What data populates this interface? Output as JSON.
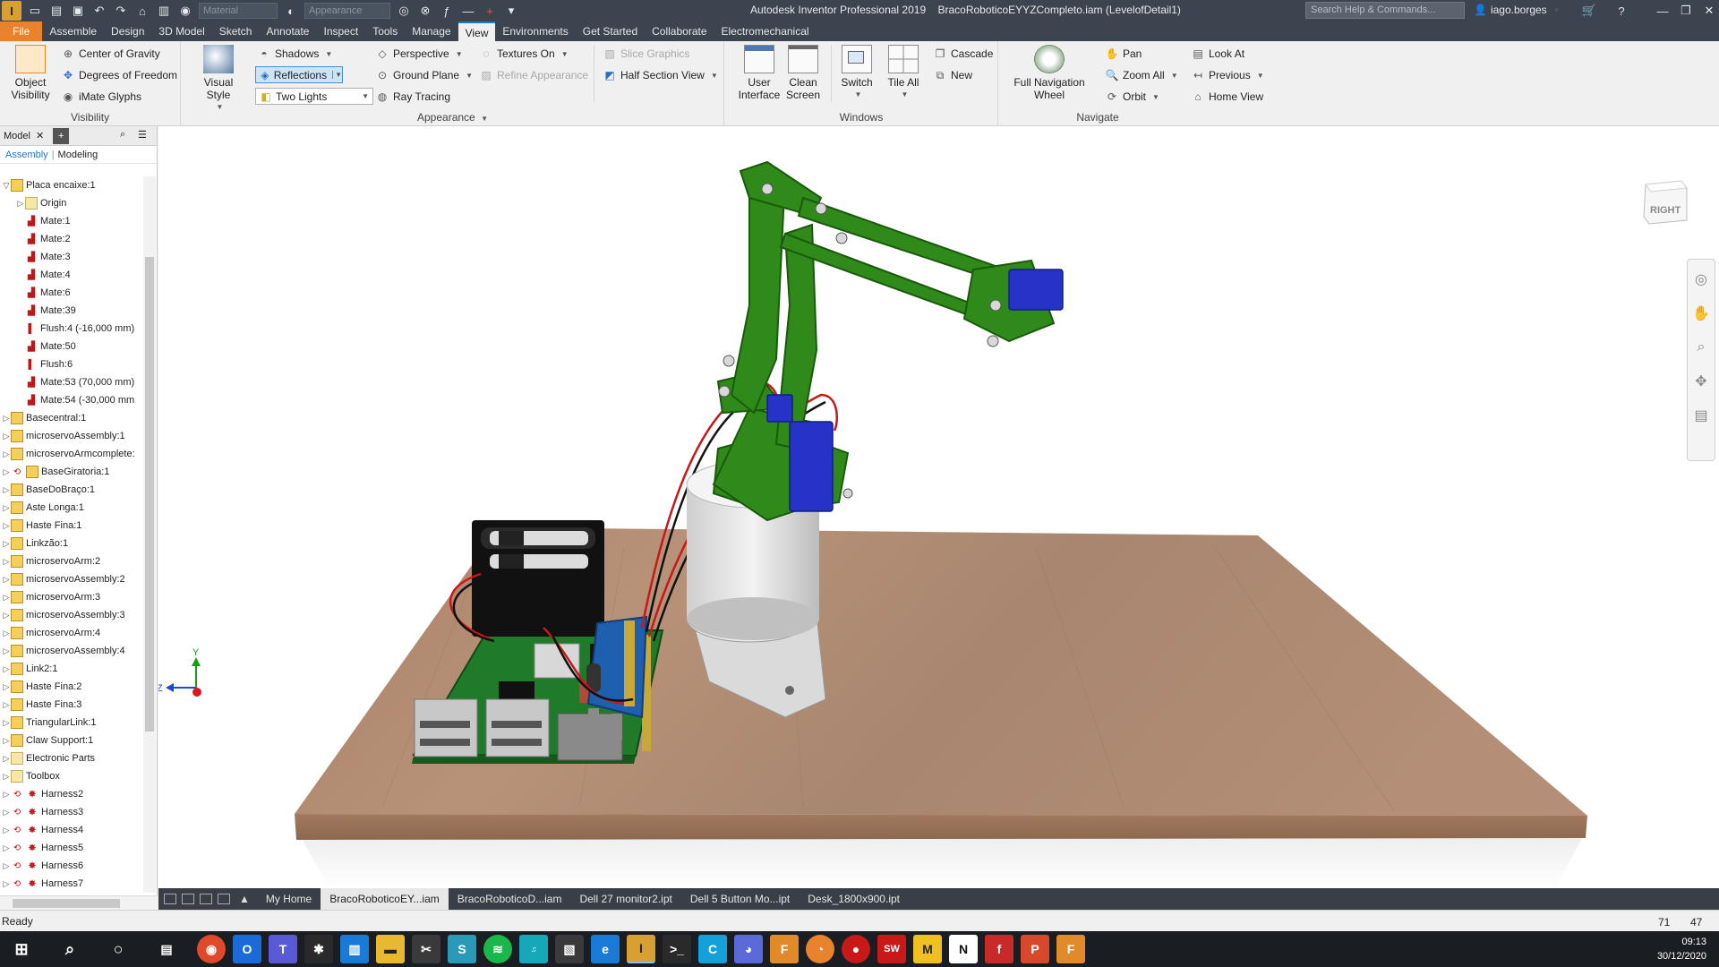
{
  "app": {
    "badge": "I",
    "title": "Autodesk Inventor Professional 2019",
    "document": "BracoRoboticoEYYZCompleto.iam (LevelofDetail1)",
    "search_placeholder": "Search Help & Commands...",
    "user": "iago.borges",
    "material_placeholder": "Material",
    "appearance_placeholder": "Appearance"
  },
  "ribbon_tabs": [
    "File",
    "Assemble",
    "Design",
    "3D Model",
    "Sketch",
    "Annotate",
    "Inspect",
    "Tools",
    "Manage",
    "View",
    "Environments",
    "Get Started",
    "Collaborate",
    "Electromechanical"
  ],
  "ribbon": {
    "visibility": {
      "object_visibility": "Object\nVisibility",
      "center_of_gravity": "Center of Gravity",
      "degrees_of_freedom": "Degrees of Freedom",
      "imate_glyphs": "iMate Glyphs",
      "label": "Visibility"
    },
    "appearance": {
      "visual_style": "Visual Style",
      "shadows": "Shadows",
      "reflections": "Reflections",
      "two_lights": "Two Lights",
      "perspective": "Perspective",
      "ground_plane": "Ground Plane",
      "ray_tracing": "Ray Tracing",
      "textures_on": "Textures On",
      "refine_appearance": "Refine Appearance",
      "slice_graphics": "Slice Graphics",
      "half_section_view": "Half Section View",
      "label": "Appearance"
    },
    "windows": {
      "user_interface": "User\nInterface",
      "clean_screen": "Clean\nScreen",
      "switch": "Switch",
      "tile_all": "Tile All",
      "cascade": "Cascade",
      "new": "New",
      "label": "Windows"
    },
    "navigate": {
      "full_nav_wheel": "Full Navigation\nWheel",
      "pan": "Pan",
      "zoom_all": "Zoom All",
      "orbit": "Orbit",
      "look_at": "Look At",
      "previous": "Previous",
      "home_view": "Home View",
      "label": "Navigate"
    }
  },
  "browser": {
    "title": "Model",
    "tabs": [
      "Assembly",
      "Modeling"
    ],
    "nodes": [
      {
        "label": "Placa encaixe:1",
        "icon": "asm",
        "level": 0,
        "exp": "▽"
      },
      {
        "label": "Origin",
        "icon": "folder",
        "level": 1,
        "exp": "▷"
      },
      {
        "label": "Mate:1",
        "icon": "mate",
        "level": 1,
        "exp": ""
      },
      {
        "label": "Mate:2",
        "icon": "mate",
        "level": 1,
        "exp": ""
      },
      {
        "label": "Mate:3",
        "icon": "mate",
        "level": 1,
        "exp": ""
      },
      {
        "label": "Mate:4",
        "icon": "mate",
        "level": 1,
        "exp": ""
      },
      {
        "label": "Mate:6",
        "icon": "mate",
        "level": 1,
        "exp": ""
      },
      {
        "label": "Mate:39",
        "icon": "mate",
        "level": 1,
        "exp": ""
      },
      {
        "label": "Flush:4 (-16,000 mm)",
        "icon": "flush",
        "level": 1,
        "exp": ""
      },
      {
        "label": "Mate:50",
        "icon": "mate",
        "level": 1,
        "exp": ""
      },
      {
        "label": "Flush:6",
        "icon": "flush",
        "level": 1,
        "exp": ""
      },
      {
        "label": "Mate:53 (70,000 mm)",
        "icon": "mate",
        "level": 1,
        "exp": ""
      },
      {
        "label": "Mate:54 (-30,000 mm",
        "icon": "mate",
        "level": 1,
        "exp": ""
      },
      {
        "label": "Basecentral:1",
        "icon": "asm",
        "level": 0,
        "exp": "▷"
      },
      {
        "label": "microservoAssembly:1",
        "icon": "asm2",
        "level": 0,
        "exp": "▷"
      },
      {
        "label": "microservoArmcomplete:",
        "icon": "asm",
        "level": 0,
        "exp": "▷"
      },
      {
        "label": "BaseGiratoria:1",
        "icon": "asm-cyc",
        "level": 0,
        "exp": "▷"
      },
      {
        "label": "BaseDoBraço:1",
        "icon": "asm",
        "level": 0,
        "exp": "▷"
      },
      {
        "label": "Aste Longa:1",
        "icon": "asm",
        "level": 0,
        "exp": "▷"
      },
      {
        "label": "Haste Fina:1",
        "icon": "asm",
        "level": 0,
        "exp": "▷"
      },
      {
        "label": "Linkzão:1",
        "icon": "asm",
        "level": 0,
        "exp": "▷"
      },
      {
        "label": "microservoArm:2",
        "icon": "asm",
        "level": 0,
        "exp": "▷"
      },
      {
        "label": "microservoAssembly:2",
        "icon": "asm2",
        "level": 0,
        "exp": "▷"
      },
      {
        "label": "microservoArm:3",
        "icon": "asm",
        "level": 0,
        "exp": "▷"
      },
      {
        "label": "microservoAssembly:3",
        "icon": "asm2",
        "level": 0,
        "exp": "▷"
      },
      {
        "label": "microservoArm:4",
        "icon": "asm",
        "level": 0,
        "exp": "▷"
      },
      {
        "label": "microservoAssembly:4",
        "icon": "asm2",
        "level": 0,
        "exp": "▷"
      },
      {
        "label": "Link2:1",
        "icon": "asm",
        "level": 0,
        "exp": "▷"
      },
      {
        "label": "Haste Fina:2",
        "icon": "asm",
        "level": 0,
        "exp": "▷"
      },
      {
        "label": "Haste Fina:3",
        "icon": "asm",
        "level": 0,
        "exp": "▷"
      },
      {
        "label": "TriangularLink:1",
        "icon": "asm",
        "level": 0,
        "exp": "▷"
      },
      {
        "label": "Claw Support:1",
        "icon": "asm",
        "level": 0,
        "exp": "▷"
      },
      {
        "label": "Electronic Parts",
        "icon": "folder",
        "level": 0,
        "exp": "▷"
      },
      {
        "label": "Toolbox",
        "icon": "folder",
        "level": 0,
        "exp": "▷"
      },
      {
        "label": "Harness2",
        "icon": "harness",
        "level": 0,
        "exp": "▷"
      },
      {
        "label": "Harness3",
        "icon": "harness",
        "level": 0,
        "exp": "▷"
      },
      {
        "label": "Harness4",
        "icon": "harness",
        "level": 0,
        "exp": "▷"
      },
      {
        "label": "Harness5",
        "icon": "harness",
        "level": 0,
        "exp": "▷"
      },
      {
        "label": "Harness6",
        "icon": "harness",
        "level": 0,
        "exp": "▷"
      },
      {
        "label": "Harness7",
        "icon": "harness",
        "level": 0,
        "exp": "▷"
      }
    ]
  },
  "viewcube_label": "RIGHT",
  "axis_labels": {
    "y": "Y",
    "z": "Z"
  },
  "doc_tabs": [
    {
      "label": "My Home",
      "active": false
    },
    {
      "label": "BracoRoboticoEY...iam",
      "active": true
    },
    {
      "label": "BracoRoboticoD...iam",
      "active": false
    },
    {
      "label": "Dell 27 monitor2.ipt",
      "active": false
    },
    {
      "label": "Dell 5 Button Mo...ipt",
      "active": false
    },
    {
      "label": "Desk_1800x900.ipt",
      "active": false
    }
  ],
  "status": {
    "text": "Ready",
    "num1": "71",
    "num2": "47"
  },
  "clock": {
    "time": "09:13",
    "date": "30/12/2020"
  },
  "colors": {
    "accent": "#1e78c8",
    "file_tab": "#e8822c",
    "arm_green": "#2f8a1a",
    "servo_blue": "#2632c8",
    "table_wood": "#b08868"
  }
}
